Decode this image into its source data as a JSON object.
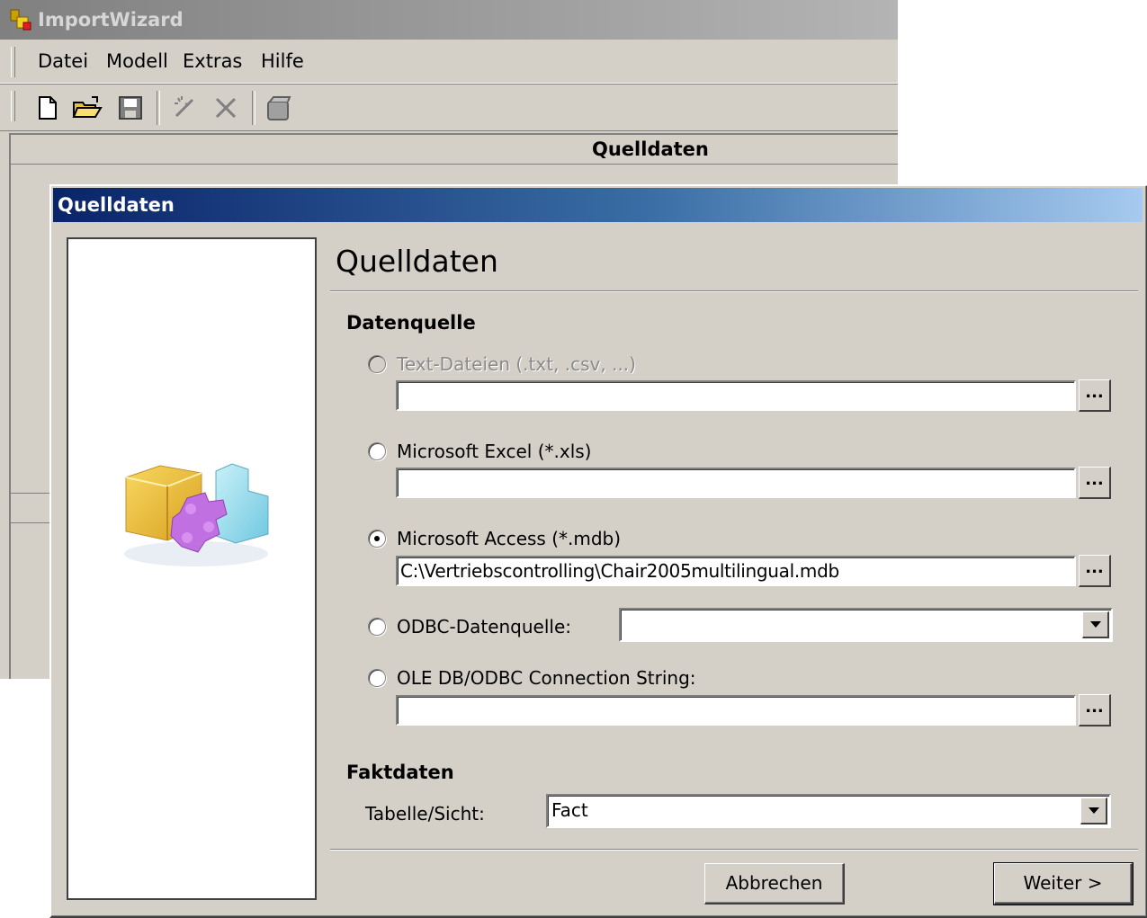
{
  "main_window": {
    "title": "ImportWizard",
    "menu": [
      "Datei",
      "Modell",
      "Extras",
      "Hilfe"
    ],
    "toolbar_icons": [
      "new-document-icon",
      "open-folder-icon",
      "save-icon",
      "wizard-wand-icon",
      "delete-icon",
      "database-icon"
    ],
    "content_header": "Quelldaten"
  },
  "dialog": {
    "title": "Quelldaten",
    "heading": "Quelldaten",
    "datasource_section": "Datenquelle",
    "options": {
      "text_files": {
        "label": "Text-Dateien (.txt, .csv, ...)",
        "value": "",
        "enabled": false,
        "selected": false
      },
      "excel": {
        "label": "Microsoft Excel (*.xls)",
        "value": "",
        "enabled": true,
        "selected": false
      },
      "access": {
        "label": "Microsoft Access (*.mdb)",
        "value": "C:\\Vertriebscontrolling\\Chair2005multilingual.mdb",
        "enabled": true,
        "selected": true
      },
      "odbc": {
        "label": "ODBC-Datenquelle:",
        "value": "",
        "enabled": true,
        "selected": false
      },
      "oledb": {
        "label": "OLE DB/ODBC Connection String:",
        "value": "",
        "enabled": true,
        "selected": false
      }
    },
    "browse_label": "...",
    "fact_section": "Faktdaten",
    "table_view_label": "Tabelle/Sicht:",
    "table_view_value": "Fact",
    "cancel_label": "Abbrechen",
    "next_label": "Weiter >"
  }
}
